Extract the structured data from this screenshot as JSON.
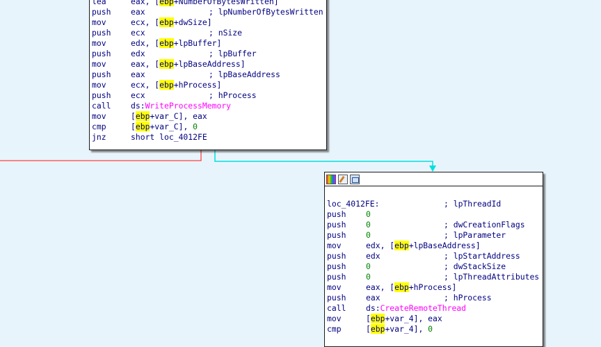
{
  "block1": {
    "lines": [
      {
        "mn": "lea",
        "parts": [
          [
            "eax, [",
            ""
          ],
          [
            "ebp",
            "hl"
          ],
          [
            "+NumberOfBytesWritten]",
            ""
          ]
        ],
        "cm": ""
      },
      {
        "mn": "push",
        "parts": [
          [
            "eax",
            ""
          ]
        ],
        "cm": "; lpNumberOfBytesWritten"
      },
      {
        "mn": "mov",
        "parts": [
          [
            "ecx, [",
            ""
          ],
          [
            "ebp",
            "hl"
          ],
          [
            "+dwSize]",
            ""
          ]
        ],
        "cm": ""
      },
      {
        "mn": "push",
        "parts": [
          [
            "ecx",
            ""
          ]
        ],
        "cm": "; nSize"
      },
      {
        "mn": "mov",
        "parts": [
          [
            "edx, [",
            ""
          ],
          [
            "ebp",
            "hl"
          ],
          [
            "+lpBuffer]",
            ""
          ]
        ],
        "cm": ""
      },
      {
        "mn": "push",
        "parts": [
          [
            "edx",
            ""
          ]
        ],
        "cm": "; lpBuffer"
      },
      {
        "mn": "mov",
        "parts": [
          [
            "eax, [",
            ""
          ],
          [
            "ebp",
            "hl"
          ],
          [
            "+lpBaseAddress]",
            ""
          ]
        ],
        "cm": ""
      },
      {
        "mn": "push",
        "parts": [
          [
            "eax",
            ""
          ]
        ],
        "cm": "; lpBaseAddress"
      },
      {
        "mn": "mov",
        "parts": [
          [
            "ecx, [",
            ""
          ],
          [
            "ebp",
            "hl"
          ],
          [
            "+hProcess]",
            ""
          ]
        ],
        "cm": ""
      },
      {
        "mn": "push",
        "parts": [
          [
            "ecx",
            ""
          ]
        ],
        "cm": "; hProcess"
      },
      {
        "mn": "call",
        "parts": [
          [
            "ds:",
            ""
          ],
          [
            "WriteProcessMemory",
            "api"
          ]
        ],
        "cm": ""
      },
      {
        "mn": "mov",
        "parts": [
          [
            "[",
            ""
          ],
          [
            "ebp",
            "hl"
          ],
          [
            "+var_C], eax",
            ""
          ]
        ],
        "cm": ""
      },
      {
        "mn": "cmp",
        "parts": [
          [
            "[",
            ""
          ],
          [
            "ebp",
            "hl"
          ],
          [
            "+var_C], ",
            ""
          ],
          [
            "0",
            "num"
          ]
        ],
        "cm": ""
      },
      {
        "mn": "jnz",
        "parts": [
          [
            "short loc_4012FE",
            ""
          ]
        ],
        "cm": ""
      }
    ]
  },
  "block2": {
    "label": "loc_4012FE:",
    "label_comment": "; lpThreadId",
    "lines": [
      {
        "mn": "push",
        "parts": [
          [
            "0",
            "num"
          ]
        ],
        "cm": ""
      },
      {
        "mn": "push",
        "parts": [
          [
            "0",
            "num"
          ]
        ],
        "cm": "; dwCreationFlags"
      },
      {
        "mn": "push",
        "parts": [
          [
            "0",
            "num"
          ]
        ],
        "cm": "; lpParameter"
      },
      {
        "mn": "mov",
        "parts": [
          [
            "edx, [",
            ""
          ],
          [
            "ebp",
            "hl"
          ],
          [
            "+lpBaseAddress]",
            ""
          ]
        ],
        "cm": ""
      },
      {
        "mn": "push",
        "parts": [
          [
            "edx",
            ""
          ]
        ],
        "cm": "; lpStartAddress"
      },
      {
        "mn": "push",
        "parts": [
          [
            "0",
            "num"
          ]
        ],
        "cm": "; dwStackSize"
      },
      {
        "mn": "push",
        "parts": [
          [
            "0",
            "num"
          ]
        ],
        "cm": "; lpThreadAttributes"
      },
      {
        "mn": "mov",
        "parts": [
          [
            "eax, [",
            ""
          ],
          [
            "ebp",
            "hl"
          ],
          [
            "+hProcess]",
            ""
          ]
        ],
        "cm": ""
      },
      {
        "mn": "push",
        "parts": [
          [
            "eax",
            ""
          ]
        ],
        "cm": "; hProcess"
      },
      {
        "mn": "call",
        "parts": [
          [
            "ds:",
            ""
          ],
          [
            "CreateRemoteThread",
            "api"
          ]
        ],
        "cm": ""
      },
      {
        "mn": "mov",
        "parts": [
          [
            "[",
            ""
          ],
          [
            "ebp",
            "hl"
          ],
          [
            "+var_4], eax",
            ""
          ]
        ],
        "cm": ""
      },
      {
        "mn": "cmp",
        "parts": [
          [
            "[",
            ""
          ],
          [
            "ebp",
            "hl"
          ],
          [
            "+var_4], ",
            ""
          ],
          [
            "0",
            "num"
          ]
        ],
        "cm": ""
      }
    ]
  },
  "colors": {
    "background": "#e8f4fb",
    "false_edge": "#ff4040",
    "true_edge": "#00e0e0",
    "register_highlight": "#ffff00",
    "api_name": "#ff00ff",
    "immediate": "#008000",
    "text": "#000080"
  },
  "icons": [
    "color-palette-icon",
    "edit-node-icon",
    "graph-overview-icon"
  ]
}
